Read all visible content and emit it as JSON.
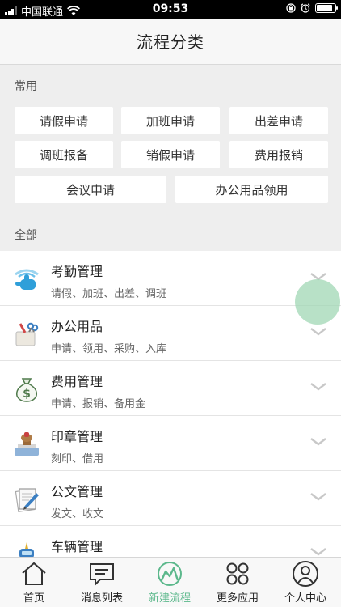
{
  "status_bar": {
    "carrier": "中国联通",
    "time": "09:53",
    "battery_percent": 85
  },
  "header": {
    "title": "流程分类"
  },
  "common": {
    "label": "常用",
    "buttons": [
      "请假申请",
      "加班申请",
      "出差申请",
      "调班报备",
      "销假申请",
      "费用报销",
      "会议申请",
      "办公用品领用"
    ]
  },
  "all": {
    "label": "全部",
    "categories": [
      {
        "name": "考勤管理",
        "sub": "请假、加班、出差、调班",
        "icon": "hand-touch-icon"
      },
      {
        "name": "办公用品",
        "sub": "申请、领用、采购、入库",
        "icon": "office-supplies-icon"
      },
      {
        "name": "费用管理",
        "sub": "申请、报销、备用金",
        "icon": "money-bag-icon"
      },
      {
        "name": "印章管理",
        "sub": "刻印、借用",
        "icon": "stamp-icon"
      },
      {
        "name": "公文管理",
        "sub": "发文、收文",
        "icon": "document-icon"
      },
      {
        "name": "车辆管理",
        "sub": "",
        "icon": "car-icon"
      }
    ]
  },
  "tabbar": {
    "tabs": [
      {
        "label": "首页",
        "icon": "home-icon",
        "active": false
      },
      {
        "label": "消息列表",
        "icon": "message-icon",
        "active": false
      },
      {
        "label": "新建流程",
        "icon": "new-process-icon",
        "active": true
      },
      {
        "label": "更多应用",
        "icon": "apps-icon",
        "active": false
      },
      {
        "label": "个人中心",
        "icon": "user-icon",
        "active": false
      }
    ]
  },
  "colors": {
    "accent": "#5cb88c",
    "background": "#eeeeee"
  }
}
